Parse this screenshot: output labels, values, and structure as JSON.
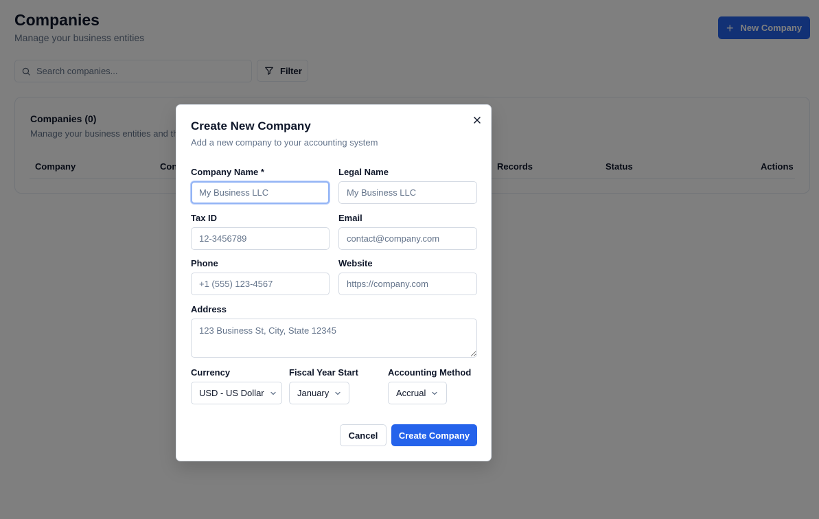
{
  "page": {
    "title": "Companies",
    "subtitle": "Manage your business entities",
    "new_button": "New Company",
    "search_placeholder": "Search companies...",
    "filter_button": "Filter"
  },
  "card": {
    "title": "Companies (0)",
    "subtitle": "Manage your business entities and the",
    "columns": [
      "Company",
      "Con",
      "Records",
      "Status",
      "Actions"
    ]
  },
  "modal": {
    "title": "Create New Company",
    "description": "Add a new company to your accounting system",
    "fields": {
      "company_name": {
        "label": "Company Name *",
        "placeholder": "My Business LLC",
        "value": ""
      },
      "legal_name": {
        "label": "Legal Name",
        "placeholder": "My Business LLC",
        "value": ""
      },
      "tax_id": {
        "label": "Tax ID",
        "placeholder": "12-3456789",
        "value": ""
      },
      "email": {
        "label": "Email",
        "placeholder": "contact@company.com",
        "value": ""
      },
      "phone": {
        "label": "Phone",
        "placeholder": "+1 (555) 123-4567",
        "value": ""
      },
      "website": {
        "label": "Website",
        "placeholder": "https://company.com",
        "value": ""
      },
      "address": {
        "label": "Address",
        "placeholder": "123 Business St, City, State 12345",
        "value": ""
      },
      "currency": {
        "label": "Currency",
        "value": "USD - US Dollar"
      },
      "fiscal_year_start": {
        "label": "Fiscal Year Start",
        "value": "January"
      },
      "accounting_method": {
        "label": "Accounting Method",
        "value": "Accrual"
      }
    },
    "cancel_button": "Cancel",
    "create_button": "Create Company"
  },
  "colors": {
    "primary": "#2563eb",
    "overlay": "rgba(0,0,0,0.5)",
    "muted_text": "#64748b",
    "border": "#e2e8f0"
  },
  "icons": [
    "plus-icon",
    "search-icon",
    "filter-icon",
    "close-icon",
    "chevron-down-icon"
  ]
}
